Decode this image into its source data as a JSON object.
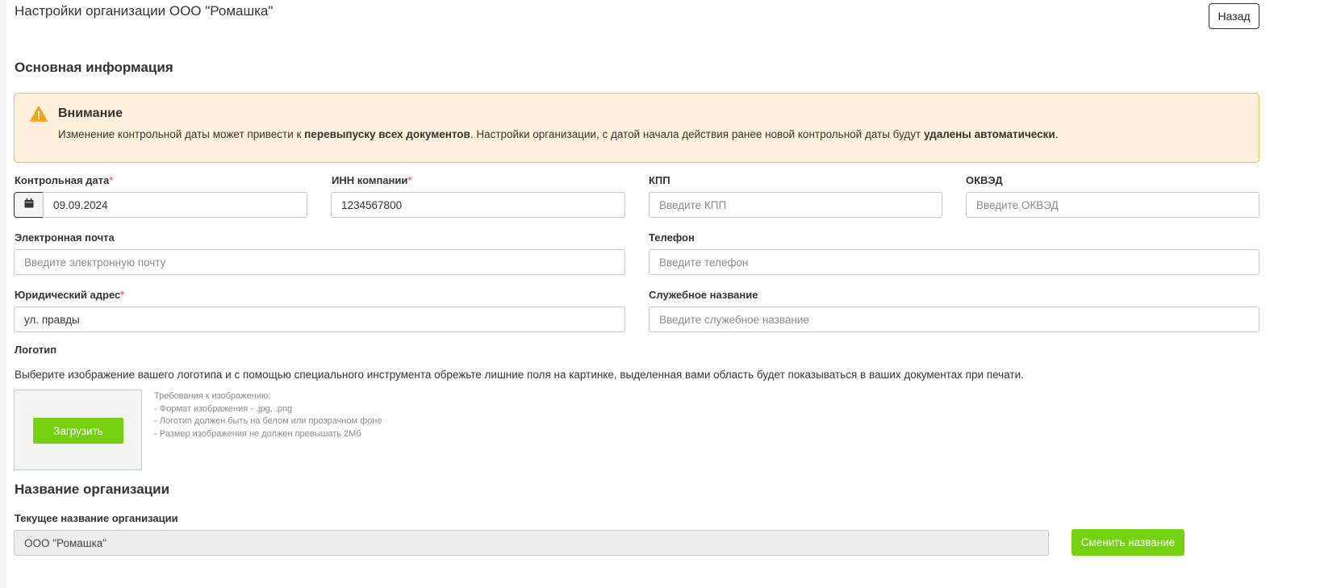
{
  "header": {
    "title": "Настройки организации ООО \"Ромашка\"",
    "back_label": "Назад"
  },
  "basic_info": {
    "section_title": "Основная информация",
    "alert": {
      "title": "Внимание",
      "text_1": "Изменение контрольной даты может привести к ",
      "text_bold_1": "перевыпуску всех документов",
      "text_2": ". Настройки организации, с датой начала действия ранее новой контрольной даты будут ",
      "text_bold_2": "удалены автоматически",
      "text_3": "."
    },
    "control_date": {
      "label": "Контрольная дата",
      "required": "*",
      "value": "09.09.2024"
    },
    "inn": {
      "label": "ИНН компании",
      "required": "*",
      "value": "1234567800"
    },
    "kpp": {
      "label": "КПП",
      "placeholder": "Введите КПП"
    },
    "okved": {
      "label": "ОКВЭД",
      "placeholder": "Введите ОКВЭД"
    },
    "email": {
      "label": "Электронная почта",
      "placeholder": "Введите электронную почту"
    },
    "phone": {
      "label": "Телефон",
      "placeholder": "Введите телефон"
    },
    "legal_address": {
      "label": "Юридический адрес",
      "required": "*",
      "value": "ул. правды"
    },
    "service_name": {
      "label": "Служебное название",
      "placeholder": "Введите служебное название"
    }
  },
  "logo": {
    "label": "Логотип",
    "help": "Выберите изображение вашего логотипа и с помощью специального инструмента обрежьте лишние поля на картинке, выделенная вами область будет показываться в ваших документах при печати.",
    "upload_label": "Загрузить",
    "requirements": [
      "Требования к изображению:",
      "- Формат изображения - .jpg, .png",
      "- Логотип должен быть на белом или прозрачном фоне",
      "- Размер изображения не должен превышать 2Мб"
    ]
  },
  "org_name": {
    "section_title": "Название организации",
    "current_label": "Текущее название организации",
    "current_value": "ООО \"Ромашка\"",
    "change_label": "Сменить название"
  },
  "colors": {
    "accent_green": "#74d10f",
    "alert_bg": "#fff0db",
    "alert_border": "#f4b84a",
    "warning_icon": "#f7a21b",
    "required_mark": "#e53935"
  },
  "icons": {
    "warning": "warning-triangle-icon",
    "calendar": "calendar-icon"
  }
}
